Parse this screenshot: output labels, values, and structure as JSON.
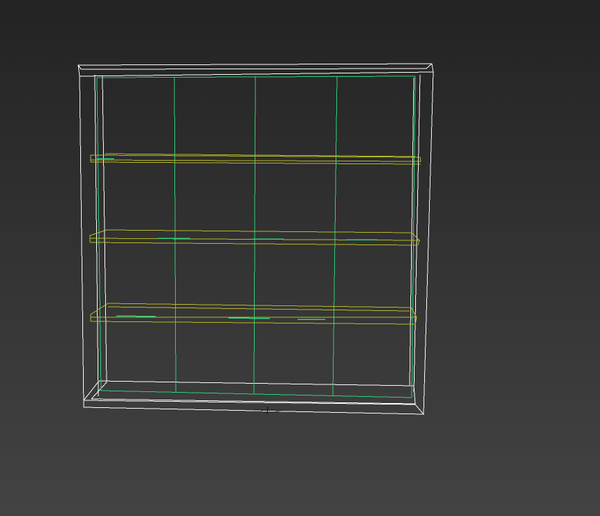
{
  "viewport": {
    "background_top": "#232323",
    "background_bottom": "#434343"
  },
  "model": {
    "object": "bookshelf",
    "frame_color": "#ffffff",
    "divider_color": "#2fd07a",
    "shelf_color": "#b8b82a",
    "shelf_count": 3,
    "vertical_divider_count": 3
  },
  "gizmo": {
    "icon": "pivot-cross-icon",
    "color": "#111111"
  }
}
